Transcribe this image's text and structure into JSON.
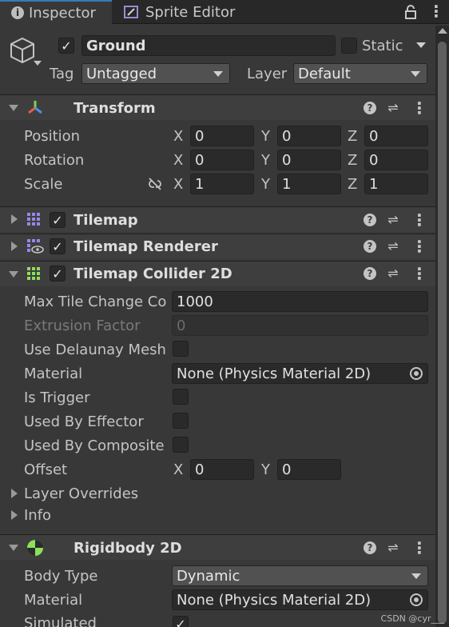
{
  "tabs": [
    {
      "label": "Inspector",
      "icon": "info-icon"
    },
    {
      "label": "Sprite Editor",
      "icon": "sprite-editor-icon"
    }
  ],
  "gameobject": {
    "active": true,
    "name": "Ground",
    "static_label": "Static",
    "static": false,
    "tag_label": "Tag",
    "tag_value": "Untagged",
    "layer_label": "Layer",
    "layer_value": "Default"
  },
  "transform": {
    "title": "Transform",
    "position_label": "Position",
    "rotation_label": "Rotation",
    "scale_label": "Scale",
    "axes": [
      "X",
      "Y",
      "Z"
    ],
    "position": [
      "0",
      "0",
      "0"
    ],
    "rotation": [
      "0",
      "0",
      "0"
    ],
    "scale": [
      "1",
      "1",
      "1"
    ]
  },
  "tilemap": {
    "title": "Tilemap",
    "enabled": true
  },
  "tilemap_renderer": {
    "title": "Tilemap Renderer",
    "enabled": true
  },
  "tilemap_collider": {
    "title": "Tilemap Collider 2D",
    "enabled": true,
    "max_tile_label": "Max Tile Change Co",
    "max_tile_value": "1000",
    "extrusion_label": "Extrusion Factor",
    "extrusion_value": "0",
    "delaunay_label": "Use Delaunay Mesh",
    "material_label": "Material",
    "material_value": "None (Physics Material 2D)",
    "is_trigger_label": "Is Trigger",
    "effector_label": "Used By Effector",
    "composite_label": "Used By Composite",
    "offset_label": "Offset",
    "offset_axes": [
      "X",
      "Y"
    ],
    "offset": [
      "0",
      "0"
    ],
    "layer_overrides_label": "Layer Overrides",
    "info_label": "Info"
  },
  "rigidbody": {
    "title": "Rigidbody 2D",
    "body_type_label": "Body Type",
    "body_type_value": "Dynamic",
    "material_label": "Material",
    "material_value": "None (Physics Material 2D)",
    "simulated_label": "Simulated",
    "simulated": true
  },
  "watermark": "CSDN @cyr___",
  "colors": {
    "accent": "#3a79bb",
    "background": "#383838",
    "header": "#3e3e3e"
  }
}
